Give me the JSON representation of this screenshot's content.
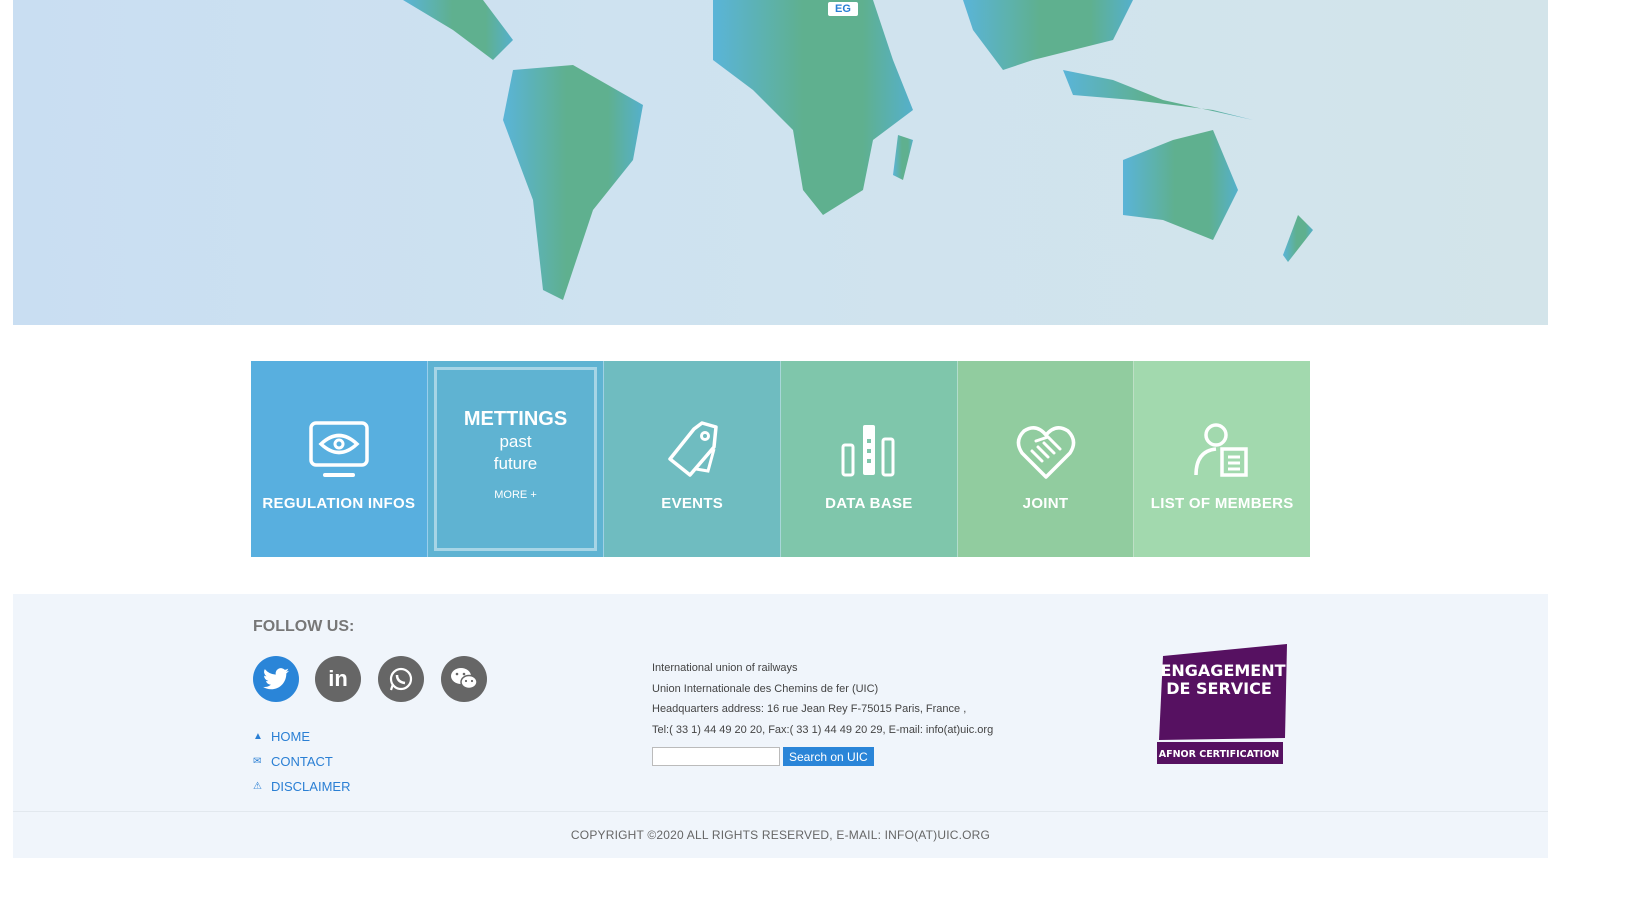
{
  "map": {
    "country_label": "EG"
  },
  "tiles": [
    {
      "label": "REGULATION INFOS",
      "icon": "eye-monitor-icon",
      "color": "#58afdf"
    },
    {
      "title": "METTINGS",
      "lines": [
        "past",
        "future"
      ],
      "more": "MORE +",
      "color": "#5fb3d2"
    },
    {
      "label": "EVENTS",
      "icon": "tag-icon",
      "color": "#6fbcc0"
    },
    {
      "label": "DATA BASE",
      "icon": "bar-chart-icon",
      "color": "#7fc6ab"
    },
    {
      "label": "JOINT",
      "icon": "handshake-heart-icon",
      "color": "#91cc9f"
    },
    {
      "label": "LIST OF MEMBERS",
      "icon": "member-list-icon",
      "color": "#a2d9ae"
    }
  ],
  "footer": {
    "follow": "FOLLOW US:",
    "social": [
      "twitter",
      "linkedin",
      "whatsapp",
      "wechat"
    ],
    "links": [
      {
        "label": "HOME",
        "icon": "home-icon"
      },
      {
        "label": "CONTACT",
        "icon": "mail-icon"
      },
      {
        "label": "DISCLAIMER",
        "icon": "warning-icon"
      }
    ],
    "address": [
      "International union of railways",
      "Union Internationale des Chemins de fer (UIC)",
      "Headquarters address: 16 rue Jean Rey F-75015 Paris, France ,",
      "Tel:( 33 1) 44 49 20 20, Fax:( 33 1) 44 49 20 29, E-mail: info(at)uic.org"
    ],
    "search_value": "",
    "search_button": "Search on UIC",
    "badge": {
      "line1": "ENGAGEMENT",
      "line2": "DE SERVICE",
      "line3": "AFNOR CERTIFICATION"
    },
    "copyright": "COPYRIGHT ©2020  ALL RIGHTS RESERVED, E-MAIL: INFO(AT)UIC.ORG"
  }
}
